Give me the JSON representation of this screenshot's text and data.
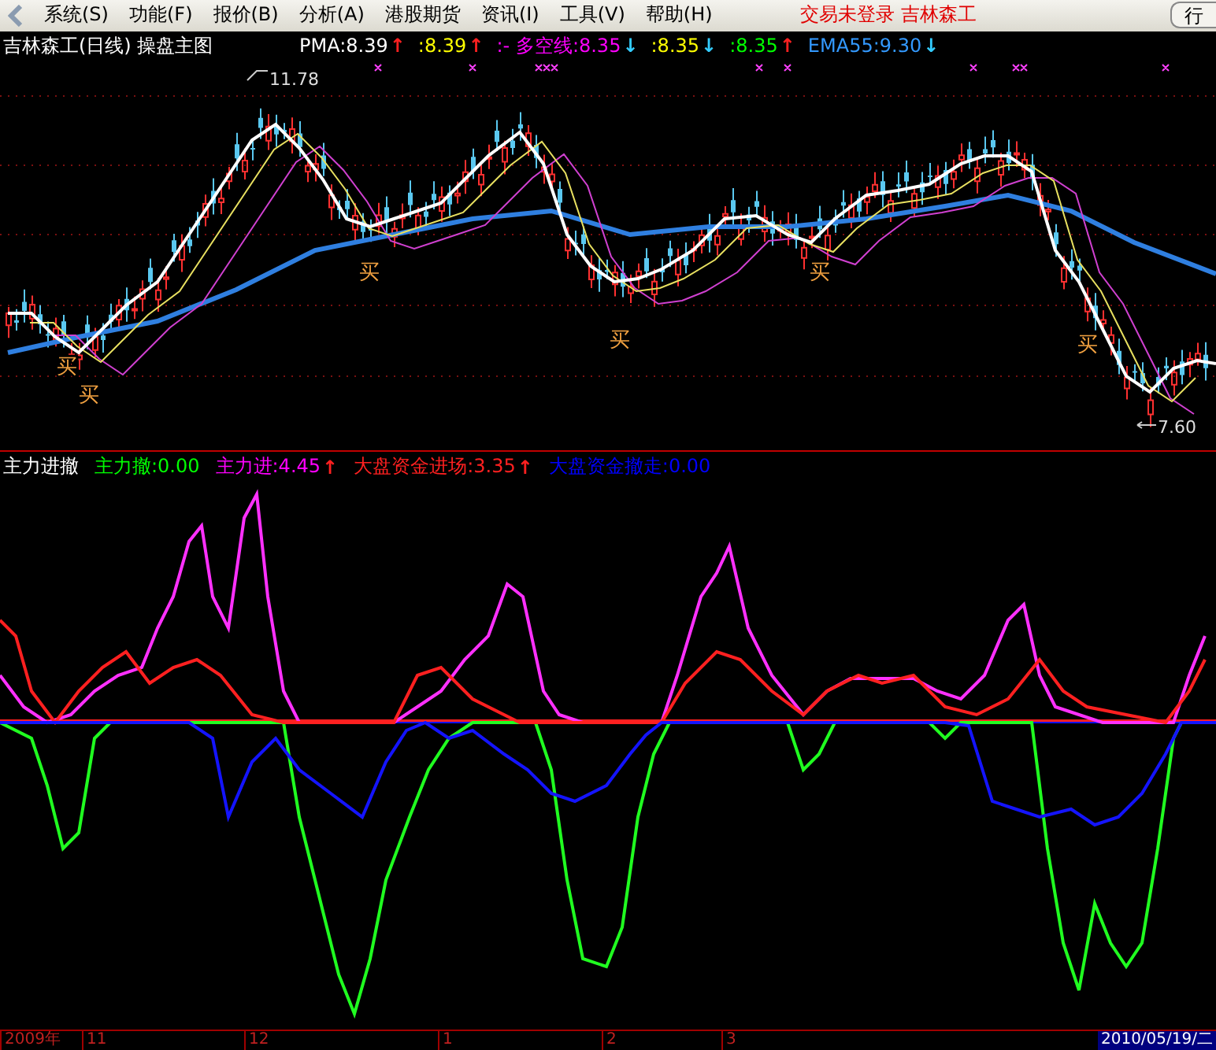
{
  "menu_bar": {
    "items": [
      "系统(S)",
      "功能(F)",
      "报价(B)",
      "分析(A)",
      "港股期货",
      "资讯(I)",
      "工具(V)",
      "帮助(H)"
    ],
    "status": "交易未登录  吉林森工",
    "button": "行"
  },
  "main_chart": {
    "title": "吉林森工(日线) 操盘主图",
    "legend": [
      {
        "text": "PMA:8.39",
        "color": "#ffffff",
        "arrow": {
          "text": "↑",
          "color": "#ff2020"
        }
      },
      {
        "text": ":8.39",
        "color": "#ffff00",
        "arrow": {
          "text": "↑",
          "color": "#ff2020"
        }
      },
      {
        "text": ":- 多空线:8.35",
        "color": "#ff00ff",
        "arrow": {
          "text": "↓",
          "color": "#33ccff"
        }
      },
      {
        "text": ":8.35",
        "color": "#ffff00",
        "arrow": {
          "text": "↓",
          "color": "#33ccff"
        }
      },
      {
        "text": ":8.35",
        "color": "#00ff00",
        "arrow": {
          "text": "↑",
          "color": "#ff2020"
        }
      },
      {
        "text": "EMA55:9.30",
        "color": "#3399ff",
        "arrow": {
          "text": "↓",
          "color": "#33ccff"
        }
      }
    ],
    "high_label": "11.78",
    "low_label": "7.60",
    "buy_markers": [
      "买",
      "买",
      "买",
      "买",
      "买",
      "买"
    ]
  },
  "indicator": {
    "title": "主力进撤",
    "legend": [
      {
        "text": "主力撤:0.00",
        "color": "#00ff00"
      },
      {
        "text": "主力进:4.45",
        "color": "#ff00ff",
        "arrow": {
          "text": "↑",
          "color": "#ff2020"
        }
      },
      {
        "text": "大盘资金进场:3.35",
        "color": "#ff2020",
        "arrow": {
          "text": "↑",
          "color": "#ff2020"
        }
      },
      {
        "text": "大盘资金撤走:0.00",
        "color": "#0000ff"
      }
    ]
  },
  "time_axis": {
    "labels": [
      "2009年",
      "11",
      "12",
      "1",
      "2",
      "3"
    ],
    "current_date": "2010/05/19/二"
  }
}
